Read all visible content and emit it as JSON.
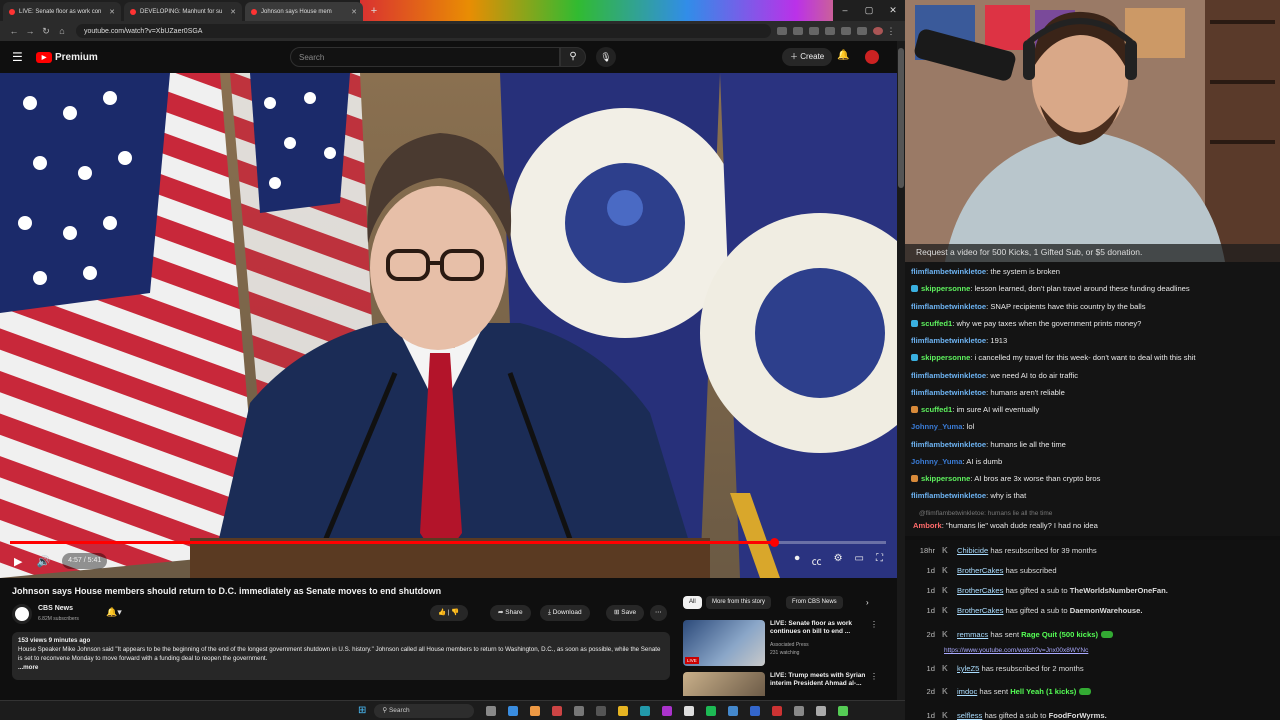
{
  "browser": {
    "tabs": [
      {
        "label": "LIVE: Senate floor as work con"
      },
      {
        "label": "DEVELOPING: Manhunt for su"
      },
      {
        "label": "Johnson says House mem"
      }
    ],
    "url": "youtube.com/watch?v=XbUZaer0SGA",
    "window_controls": [
      "–",
      "▢",
      "✕"
    ]
  },
  "youtube": {
    "brand": "Premium",
    "search_placeholder": "Search",
    "create_label": "Create",
    "video": {
      "title": "Johnson says House members should return to D.C. immediately as Senate moves to end shutdown",
      "time": "4:57 / 5:41",
      "progress_fraction": 0.873,
      "channel": "CBS News",
      "subscribers": "6.82M subscribers",
      "actions": {
        "share": "Share",
        "download": "Download",
        "save": "Save"
      },
      "description": {
        "meta": "153 views  9 minutes ago",
        "text": "House Speaker Mike Johnson said \"It appears to be the beginning of the end of the longest government shutdown in U.S. history.\" Johnson called all House members to return to Washington, D.C., as soon as possible, while the Senate is set to reconvene Monday to move forward with a funding deal to reopen the government.",
        "more": "...more"
      }
    },
    "chips": [
      "All",
      "More from this story",
      "From CBS News"
    ],
    "recommendations": [
      {
        "title": "LIVE: Senate floor as work continues on bill to end ...",
        "channel": "Associated Press",
        "meta": "231 watching",
        "badge": "LIVE"
      },
      {
        "title": "LIVE: Trump meets with Syrian interim President Ahmad al-...",
        "channel": "",
        "meta": "",
        "badge": ""
      }
    ]
  },
  "taskbar": {
    "search": "Search"
  },
  "stream": {
    "overlay_text": "Request a video for 500 Kicks, 1 Gifted Sub, or $5 donation."
  },
  "chat": {
    "messages": [
      {
        "user": "flimflambetwinkletoe",
        "text": " the system is broken",
        "color": "#6db3f2"
      },
      {
        "user": "skippersonne",
        "text": " lesson learned, don't plan travel around these funding deadlines",
        "color": "#5ef25e"
      },
      {
        "user": "flimflambetwinkletoe",
        "text": " SNAP recipients have this country by the balls",
        "color": "#6db3f2"
      },
      {
        "user": "scuffed1",
        "text": " why we pay taxes when the government prints money?",
        "color": "#5ef25e"
      },
      {
        "user": "flimflambetwinkletoe",
        "text": " 1913",
        "color": "#6db3f2"
      },
      {
        "user": "skippersonne",
        "text": " i cancelled my travel for this week- don't want to deal with this shit",
        "color": "#5ef25e"
      },
      {
        "user": "flimflambetwinkletoe",
        "text": " we need AI to do air traffic",
        "color": "#6db3f2"
      },
      {
        "user": "flimflambetwinkletoe",
        "text": " humans aren't reliable",
        "color": "#6db3f2"
      },
      {
        "user": "scuffed1",
        "text": " im sure AI will eventually",
        "color": "#5ef25e"
      },
      {
        "user": "Johnny_Yuma",
        "text": " lol",
        "color": "#3a7bd5"
      },
      {
        "user": "flimflambetwinkletoe",
        "text": " humans lie all the time",
        "color": "#6db3f2"
      },
      {
        "user": "Johnny_Yuma",
        "text": " AI is dumb",
        "color": "#3a7bd5"
      },
      {
        "user": "skippersonne",
        "text": " AI bros are 3x worse than crypto bros",
        "color": "#5ef25e"
      },
      {
        "user": "flimflambetwinkletoe",
        "text": " why is that",
        "color": "#6db3f2"
      }
    ],
    "reply_context": "@flimflambetwinkletoe: humans lie all the time",
    "last_message": {
      "user": "Ambork",
      "text": " \"humans lie\" woah dude really? I had no idea",
      "color": "#ff6b6b"
    }
  },
  "events": [
    {
      "time": "18hr",
      "name": "Chibicide",
      "text": " has resubscribed for 39 months",
      "extra": ""
    },
    {
      "time": "1d",
      "name": "BrotherCakes",
      "text": " has subscribed",
      "extra": ""
    },
    {
      "time": "1d",
      "name": "BrotherCakes",
      "text": " has gifted a sub to ",
      "extra": "TheWorldsNumberOneFan."
    },
    {
      "time": "1d",
      "name": "BrotherCakes",
      "text": " has gifted a sub to ",
      "extra": "DaemonWarehouse."
    },
    {
      "time": "2d",
      "name": "remmacs",
      "text": " has sent ",
      "extra": "Rage Quit (500 kicks)"
    },
    {
      "time": "1d",
      "name": "kyleZ5",
      "text": " has resubscribed for 2 months",
      "extra": ""
    },
    {
      "time": "2d",
      "name": "imdoc",
      "text": " has sent ",
      "extra": "Hell Yeah (1 kicks)"
    },
    {
      "time": "1d",
      "name": "selfless",
      "text": " has gifted a sub to ",
      "extra": "FoodForWyrms."
    }
  ],
  "event_link": "https://www.youtube.com/watch?v=Jnx00x8WYNc"
}
